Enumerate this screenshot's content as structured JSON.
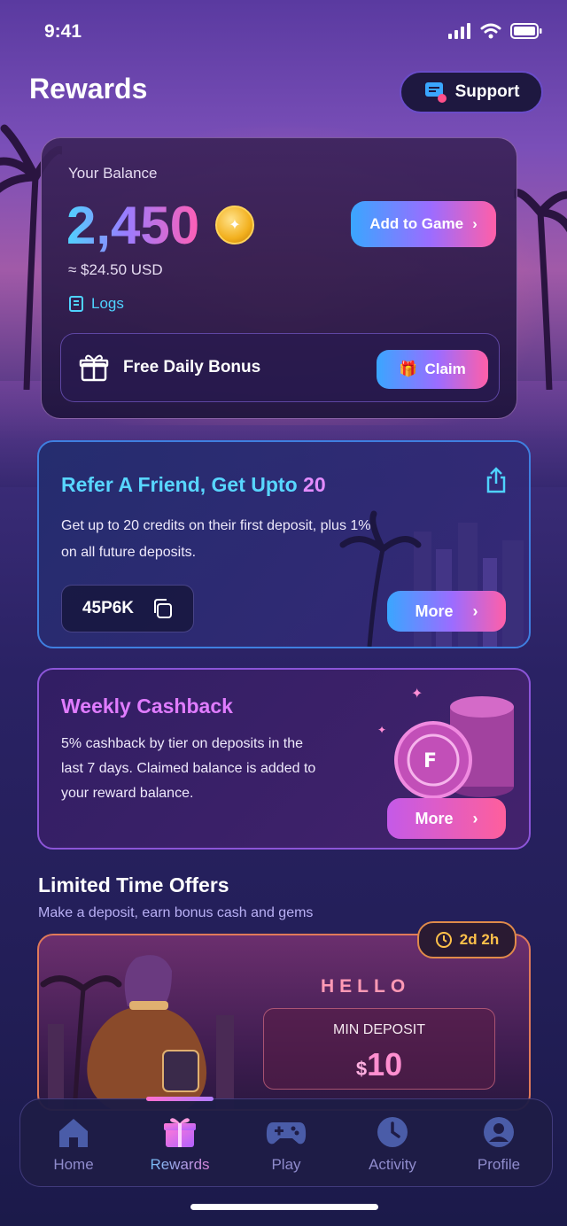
{
  "status_bar": {
    "time": "9:41"
  },
  "header": {
    "title": "Rewards",
    "support_label": "Support"
  },
  "balance": {
    "label": "Your Balance",
    "amount": "2,450",
    "usd": "≈ $24.50 USD",
    "logs_label": "Logs",
    "add_to_game_label": "Add to Game",
    "bonus_label": "Free Daily Bonus",
    "claim_label": "Claim"
  },
  "refer": {
    "title": "Refer A Friend, Get Upto ",
    "title_num": "20",
    "description": "Get up to 20 credits on their first deposit, plus 1% on all future deposits.",
    "code": "45P6K",
    "more_label": "More"
  },
  "cashback": {
    "title": "Weekly Cashback",
    "description": "5% cashback by tier on deposits in the last 7 days. Claimed balance is added to your reward balance.",
    "more_label": "More"
  },
  "offers": {
    "title": "Limited Time Offers",
    "subtitle": "Make a deposit, earn bonus cash and gems",
    "timer": "2d 2h",
    "card_title": "HELLO",
    "min_label": "MIN DEPOSIT",
    "currency": "$",
    "min_value": "10"
  },
  "tabs": [
    {
      "label": "Home",
      "icon": "home-icon"
    },
    {
      "label": "Rewards",
      "icon": "gift-icon"
    },
    {
      "label": "Play",
      "icon": "gamepad-icon"
    },
    {
      "label": "Activity",
      "icon": "clock-icon"
    },
    {
      "label": "Profile",
      "icon": "user-icon"
    }
  ],
  "active_tab": "Rewards",
  "colors": {
    "accent_cyan": "#4fd3ff",
    "accent_pink": "#ff5fa8",
    "accent_purple": "#9c6cff"
  }
}
